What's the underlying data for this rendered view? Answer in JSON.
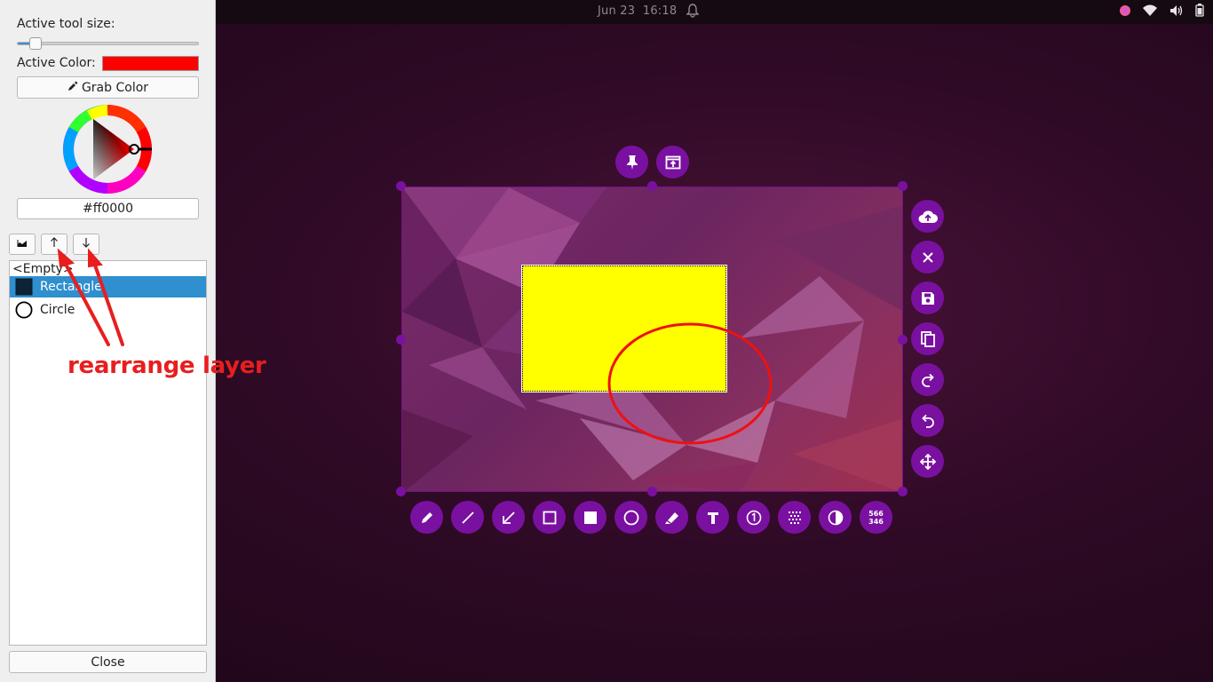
{
  "topbar": {
    "date": "Jun 23",
    "time": "16:18"
  },
  "panel": {
    "tool_size_label": "Active tool size:",
    "tool_size_fraction": 0.07,
    "active_color_label": "Active Color:",
    "active_color": "#ff0000",
    "grab_color_label": "Grab Color",
    "hex_value": "#ff0000",
    "layers": {
      "empty": "<Empty>",
      "items": [
        {
          "label": "Rectangle",
          "selected": true
        },
        {
          "label": "Circle",
          "selected": false
        }
      ]
    },
    "close_label": "Close"
  },
  "annotation": {
    "text": "rearrange layer",
    "color": "#e81e1e"
  },
  "canvas": {
    "accent": "#7a10a0",
    "rect_fill": "#ffff00",
    "ellipse_stroke": "#ee1111"
  },
  "toolbar": {
    "size_width": "566",
    "size_height": "346",
    "top_tools": [
      "pin-icon",
      "launch-app-icon"
    ],
    "side_tools": [
      "upload-cloud-icon",
      "close-icon",
      "save-icon",
      "copy-icon",
      "redo-icon",
      "undo-icon",
      "move-icon"
    ],
    "bottom_tools": [
      "pencil-icon",
      "line-icon",
      "arrow-icon",
      "rectangle-outline-icon",
      "rectangle-filled-icon",
      "circle-icon",
      "marker-icon",
      "text-icon",
      "circle-counter-icon",
      "pixelate-icon",
      "invert-icon",
      "size-indicator"
    ]
  }
}
